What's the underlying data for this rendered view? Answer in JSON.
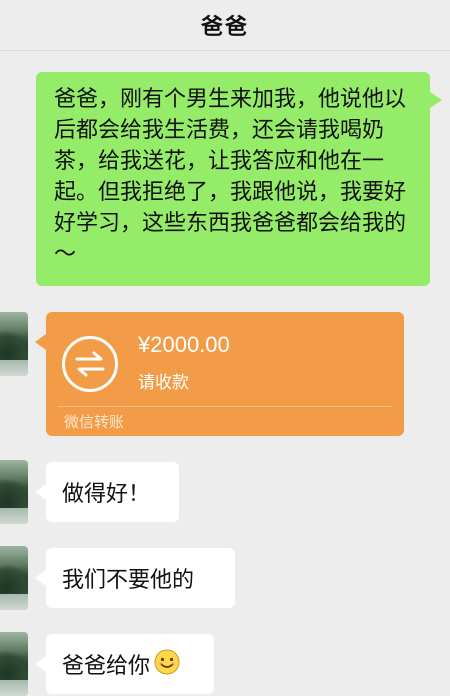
{
  "header": {
    "title": "爸爸"
  },
  "messages": {
    "outgoing_text": "爸爸，刚有个男生来加我，他说他以后都会给我生活费，还会请我喝奶茶，给我送花，让我答应和他在一起。但我拒绝了，我跟他说，我要好好学习，这些东西我爸爸都会给我的～",
    "transfer": {
      "amount": "¥2000.00",
      "status": "请收款",
      "footer": "微信转账",
      "icon": "transfer-arrows-icon"
    },
    "incoming": [
      {
        "text": "做得好！"
      },
      {
        "text": "我们不要他的"
      },
      {
        "text": "爸爸给你",
        "emoji": "smiley-icon"
      }
    ]
  },
  "colors": {
    "background": "#ededed",
    "outgoing_bubble": "#95ec69",
    "transfer_card": "#f29c47",
    "incoming_bubble": "#ffffff"
  }
}
